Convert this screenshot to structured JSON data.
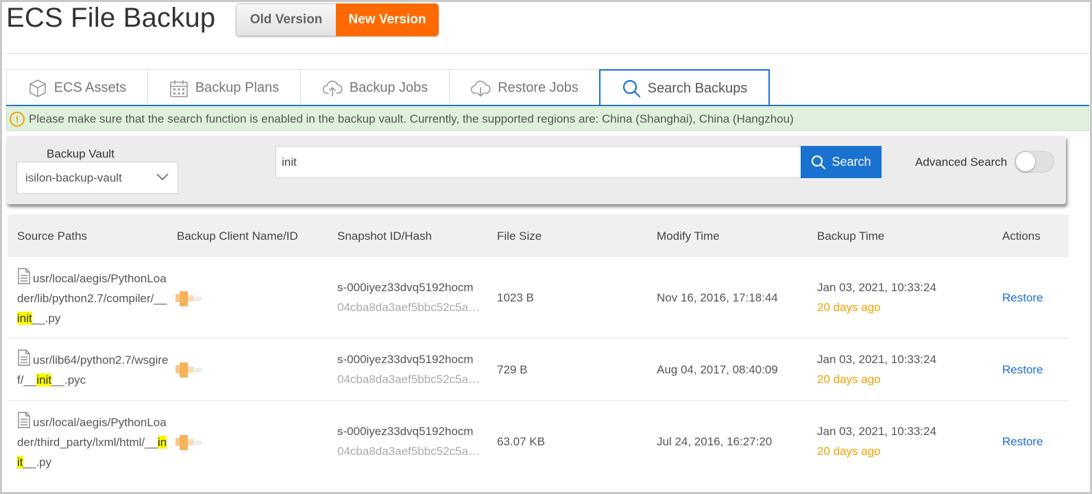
{
  "header": {
    "title": "ECS File Backup",
    "version_old": "Old Version",
    "version_new": "New Version"
  },
  "tabs": [
    {
      "label": "ECS Assets",
      "icon": "cube-icon"
    },
    {
      "label": "Backup Plans",
      "icon": "calendar-icon"
    },
    {
      "label": "Backup Jobs",
      "icon": "cloud-upload-icon"
    },
    {
      "label": "Restore Jobs",
      "icon": "cloud-download-icon"
    },
    {
      "label": "Search Backups",
      "icon": "search-icon",
      "active": true
    }
  ],
  "notice": {
    "text": "Please make sure that the search function is enabled in the backup vault. Currently, the supported regions are: China (Shanghai), China (Hangzhou)"
  },
  "search": {
    "vault_label": "Backup Vault",
    "vault_value": "isilon-backup-vault",
    "query": "init",
    "button_label": "Search",
    "advanced_label": "Advanced Search",
    "advanced_enabled": false
  },
  "table": {
    "headers": [
      "Source Paths",
      "Backup Client Name/ID",
      "Snapshot ID/Hash",
      "File Size",
      "Modify Time",
      "Backup Time",
      "Actions"
    ],
    "rows": [
      {
        "path_before": "usr/local/aegis/PythonLoader/lib/python2.7/compiler/__",
        "path_match": "init",
        "path_after": "__.py",
        "snapshot_id": "s-000iyez33dvq5192hocm",
        "snapshot_hash": "04cba8da3aef5bbc52c5a…",
        "file_size": "1023 B",
        "modify_time": "Nov 16, 2016, 17:18:44",
        "backup_time": "Jan 03, 2021, 10:33:24",
        "backup_ago": "20 days ago",
        "action": "Restore"
      },
      {
        "path_before": "usr/lib64/python2.7/wsgiref/__",
        "path_match": "init",
        "path_after": "__.pyc",
        "snapshot_id": "s-000iyez33dvq5192hocm",
        "snapshot_hash": "04cba8da3aef5bbc52c5a…",
        "file_size": "729 B",
        "modify_time": "Aug 04, 2017, 08:40:09",
        "backup_time": "Jan 03, 2021, 10:33:24",
        "backup_ago": "20 days ago",
        "action": "Restore"
      },
      {
        "path_before": "usr/local/aegis/PythonLoader/third_party/lxml/html/__",
        "path_match": "init",
        "path_after": "__.py",
        "snapshot_id": "s-000iyez33dvq5192hocm",
        "snapshot_hash": "04cba8da3aef5bbc52c5a…",
        "file_size": "63.07 KB",
        "modify_time": "Jul 24, 2016, 16:27:20",
        "backup_time": "Jan 03, 2021, 10:33:24",
        "backup_ago": "20 days ago",
        "action": "Restore"
      }
    ]
  },
  "colors": {
    "accent": "#1a6fd4",
    "brand_orange": "#ff6a00",
    "notice_bg": "#dff0dc",
    "warning": "#f0a500",
    "highlight": "#f8f800"
  }
}
